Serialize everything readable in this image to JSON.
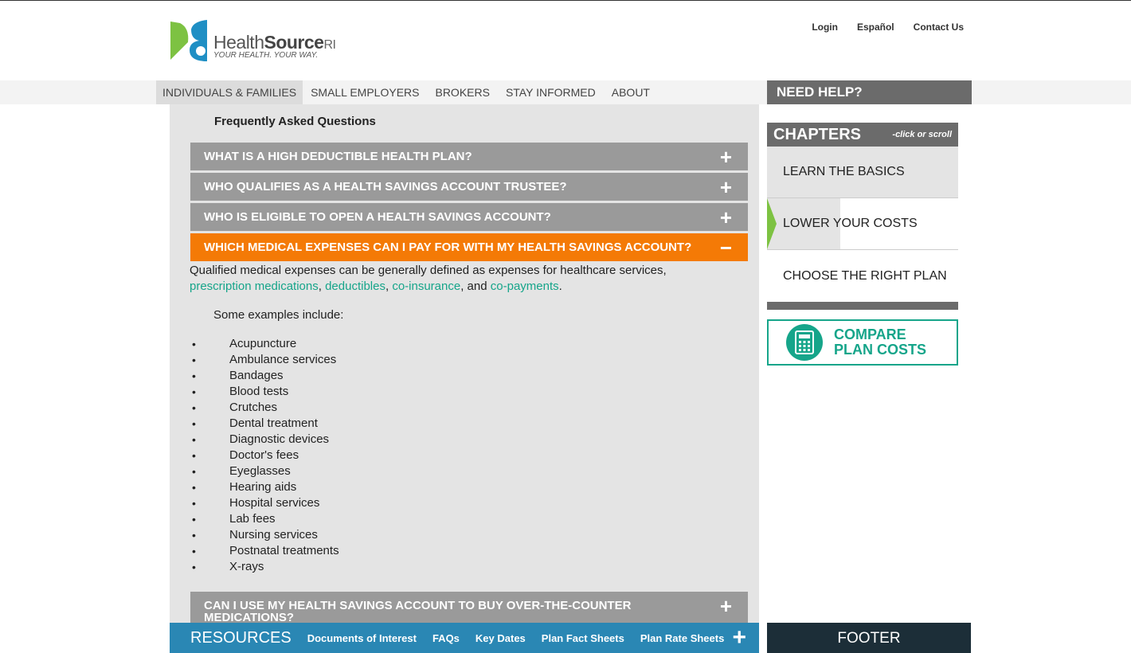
{
  "header": {
    "logo": {
      "name": "Health",
      "name_bold": "Source",
      "suffix": "RI",
      "tagline": "YOUR HEALTH. YOUR WAY."
    },
    "utility_links": [
      "Login",
      "Español",
      "Contact Us"
    ]
  },
  "nav": {
    "items": [
      "INDIVIDUALS & FAMILIES",
      "SMALL EMPLOYERS",
      "BROKERS",
      "STAY INFORMED",
      "ABOUT"
    ],
    "need_help": "NEED HELP?"
  },
  "faq": {
    "heading": "Frequently Asked Questions",
    "questions": [
      {
        "q": "WHAT IS A HIGH DEDUCTIBLE HEALTH PLAN?",
        "sign": "+"
      },
      {
        "q": "WHO QUALIFIES AS A HEALTH SAVINGS ACCOUNT TRUSTEE?",
        "sign": "+"
      },
      {
        "q": "WHO IS ELIGIBLE TO OPEN A HEALTH SAVINGS ACCOUNT?",
        "sign": "+"
      },
      {
        "q": "WHICH MEDICAL EXPENSES CAN I PAY FOR WITH MY HEALTH SAVINGS ACCOUNT?",
        "sign": "−"
      },
      {
        "q": "CAN I USE MY HEALTH SAVINGS ACCOUNT TO BUY OVER-THE-COUNTER MEDICATIONS?",
        "sign": "+"
      }
    ],
    "answer": {
      "intro": "Qualified medical expenses can be generally defined as expenses for healthcare services,",
      "link1": "prescription medications",
      "link2": "deductibles",
      "link3": "co-insurance",
      "and_text": ", and",
      "link4": "co-payments",
      "examples_label": "Some examples include:",
      "bullet": "•",
      "items": [
        "Acupuncture",
        "Ambulance services",
        "Bandages",
        "Blood tests",
        "Crutches",
        "Dental treatment",
        "Diagnostic devices",
        "Doctor's fees",
        "Eyeglasses",
        "Hearing aids",
        "Hospital services",
        "Lab fees",
        "Nursing services",
        "Postnatal treatments",
        "X-rays"
      ]
    }
  },
  "resources": {
    "title": "RESOURCES",
    "links": [
      "Documents of Interest",
      "FAQs",
      "Key Dates",
      "Plan Fact Sheets",
      "Plan Rate Sheets"
    ],
    "toggle": "+"
  },
  "sidebar": {
    "chapters_title": "CHAPTERS",
    "chapters_hint": "-click or scroll",
    "chapters": [
      "LEARN THE BASICS",
      "LOWER YOUR COSTS",
      "CHOOSE THE RIGHT PLAN"
    ],
    "compare_line1": "COMPARE",
    "compare_line2": "PLAN COSTS",
    "footer": "FOOTER"
  },
  "colors": {
    "accent_orange": "#f47a06",
    "link_teal": "#16a58a",
    "resources_blue": "#2a87b4",
    "logo_green": "#7dc242",
    "logo_blue": "#1f8fc4"
  }
}
